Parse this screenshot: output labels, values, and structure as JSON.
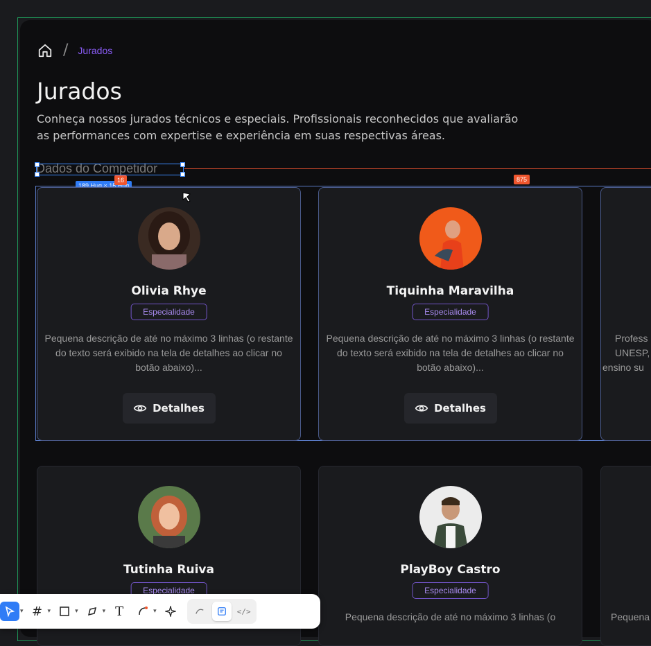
{
  "breadcrumb": {
    "separator": "/",
    "current": "Jurados"
  },
  "page": {
    "title": "Jurados",
    "description": "Conheça nossos jurados técnicos e especiais. Profissionais reconhecidos que avaliarão as performances com expertise e experiência em suas respectivas áreas."
  },
  "section": {
    "label": "Dados do Competidor",
    "size_badge": "189 Hug × 15 Hug",
    "gap_badge": "16",
    "distance_badge": "875"
  },
  "cards": [
    {
      "name": "Olivia Rhye",
      "tag": "Especialidade",
      "description": "Pequena descrição de até no máximo 3 linhas (o restante do texto será exibido na tela de detalhes ao clicar no botão abaixo)...",
      "button": "Detalhes",
      "avatar_color": "#5a3a2a"
    },
    {
      "name": "Tiquinha Maravilha",
      "tag": "Especialidade",
      "description": "Pequena descrição de até no máximo 3 linhas (o restante do texto será exibido na tela de detalhes ao clicar no botão abaixo)...",
      "button": "Detalhes",
      "avatar_color": "#f05a1a"
    },
    {
      "name": "Tutinha Ruiva",
      "tag": "Especialidade",
      "avatar_color": "#6b8a5a"
    },
    {
      "name": "PlayBoy Castro",
      "tag": "Especialidade",
      "description_partial": "Pequena descrição de até no máximo 3 linhas (o",
      "avatar_color": "#e8e8e8"
    }
  ],
  "partial_card": {
    "lines": [
      "Profess",
      "UNESP,",
      "ensino su"
    ],
    "bottom": "Pequena"
  },
  "toolbar": {
    "tools": [
      "move-tool",
      "frame-tool",
      "rectangle-tool",
      "pen-tool",
      "text-tool",
      "shape-tool",
      "actions-tool"
    ],
    "modes": [
      "draw-mode",
      "design-mode",
      "dev-mode"
    ]
  },
  "colors": {
    "accent": "#8a5cf6",
    "background": "#0d0d0f",
    "card": "#1a1b1e"
  }
}
